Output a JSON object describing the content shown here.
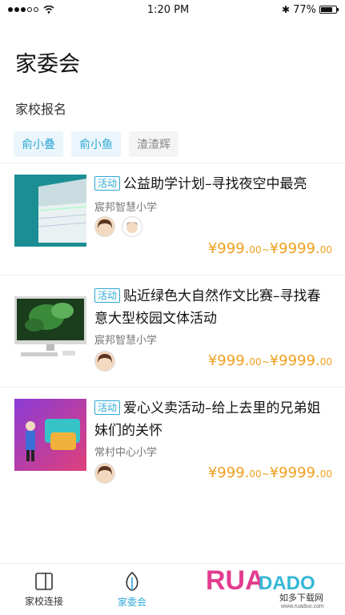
{
  "status": {
    "time": "1:20 PM",
    "battery": "77%"
  },
  "header": {
    "title": "家委会"
  },
  "section": {
    "label": "家校报名"
  },
  "tags": [
    "俞小叠",
    "俞小鱼",
    "渣渣辉"
  ],
  "cards": [
    {
      "badge": "活动",
      "title": "公益助学计划–寻找夜空中最亮",
      "school": "宸邦智慧小学",
      "price_from": "¥999.",
      "from_dec": "00",
      "sep": "~",
      "price_to": "¥9999.",
      "to_dec": "00"
    },
    {
      "badge": "活动",
      "title": "贴近绿色大自然作文比赛–寻找春意大型校园文体活动",
      "school": "宸邦智慧小学",
      "price_from": "¥999.",
      "from_dec": "00",
      "sep": "~",
      "price_to": "¥9999.",
      "to_dec": "00"
    },
    {
      "badge": "活动",
      "title": "爱心义卖活动–给上去里的兄弟姐妹们的关怀",
      "school": "常村中心小学",
      "price_from": "¥999.",
      "from_dec": "00",
      "sep": "~",
      "price_to": "¥9999.",
      "to_dec": "00"
    }
  ],
  "tabbar": {
    "tab1": "家校连接",
    "tab2": "家委会"
  },
  "watermark": {
    "brand": "RUANDAO",
    "site": "www.ruaduo.com",
    "cn": "如多下载网"
  }
}
